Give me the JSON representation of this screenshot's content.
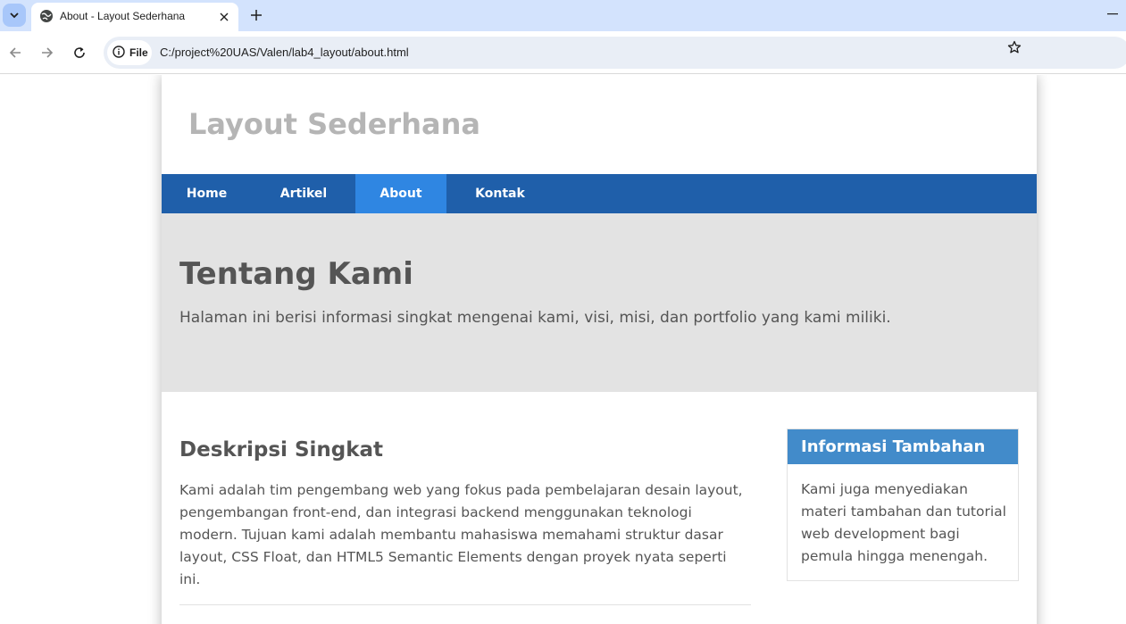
{
  "browser": {
    "tab_title": "About - Layout Sederhana",
    "url": "C:/project%20UAS/Valen/lab4_layout/about.html",
    "site_chip_label": "File",
    "icons": [
      "tab-search-icon",
      "globe-icon",
      "close-icon",
      "plus-icon",
      "minimize-icon",
      "back-arrow-icon",
      "forward-arrow-icon",
      "reload-icon",
      "info-icon",
      "star-icon"
    ]
  },
  "page": {
    "site_title": "Layout Sederhana",
    "nav": {
      "items": [
        "Home",
        "Artikel",
        "About",
        "Kontak"
      ],
      "active": "About"
    },
    "hero": {
      "title": "Tentang Kami",
      "text": "Halaman ini berisi informasi singkat mengenai kami, visi, misi, dan portfolio yang kami miliki."
    },
    "main": {
      "title": "Deskripsi Singkat",
      "text": "Kami adalah tim pengembang web yang fokus pada pembelajaran desain layout, pengembangan front-end, dan integrasi backend menggunakan teknologi modern. Tujuan kami adalah membantu mahasiswa memahami struktur dasar layout, CSS Float, dan HTML5 Semantic Elements dengan proyek nyata seperti ini."
    },
    "sidebar": {
      "title": "Informasi Tambahan",
      "text": "Kami juga menyediakan materi tambahan dan tutorial web development bagi pemula hingga menengah."
    },
    "colors": {
      "nav_bg": "#1f5faa",
      "nav_active": "#2f86e2",
      "widget_head": "#428bca",
      "hero_bg": "#e3e3e3",
      "site_title": "#b5b5b5"
    }
  }
}
